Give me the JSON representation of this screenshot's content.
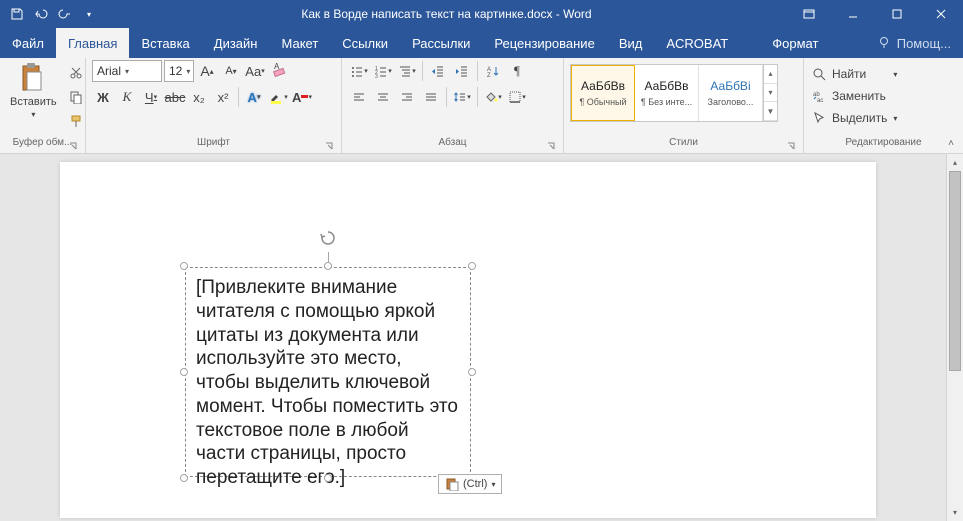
{
  "title": "Как в Ворде написать текст на картинке.docx - Word",
  "tabs": [
    "Файл",
    "Главная",
    "Вставка",
    "Дизайн",
    "Макет",
    "Ссылки",
    "Рассылки",
    "Рецензирование",
    "Вид",
    "ACROBAT"
  ],
  "active_tab_index": 1,
  "context_tab": "Формат",
  "tell_me": "Помощ...",
  "clipboard": {
    "paste": "Вставить",
    "label": "Буфер обм..."
  },
  "font": {
    "name": "Arial",
    "size": "12",
    "bold": "Ж",
    "italic": "К",
    "underline": "Ч",
    "strike": "abc",
    "sub": "x₂",
    "sup": "x²",
    "case": "Aa",
    "clear": "",
    "grow": "A",
    "shrink": "A",
    "effects": "A",
    "highlight": "",
    "color": "A",
    "label": "Шрифт"
  },
  "para": {
    "label": "Абзац"
  },
  "styles": {
    "label": "Стили",
    "items": [
      {
        "preview": "АаБбВв",
        "name": "¶ Обычный"
      },
      {
        "preview": "АаБбВв",
        "name": "¶ Без инте..."
      },
      {
        "preview": "АаБбВі",
        "name": "Заголово..."
      }
    ]
  },
  "editing": {
    "label": "Редактирование",
    "find": "Найти",
    "replace": "Заменить",
    "select": "Выделить"
  },
  "textbox_content": "[Привлеките внимание читателя с помощью яркой цитаты из документа или используйте это место, чтобы выделить ключевой момент. Чтобы поместить это текстовое поле в любой части страницы, просто перетащите его.]",
  "paste_options": "(Ctrl)"
}
